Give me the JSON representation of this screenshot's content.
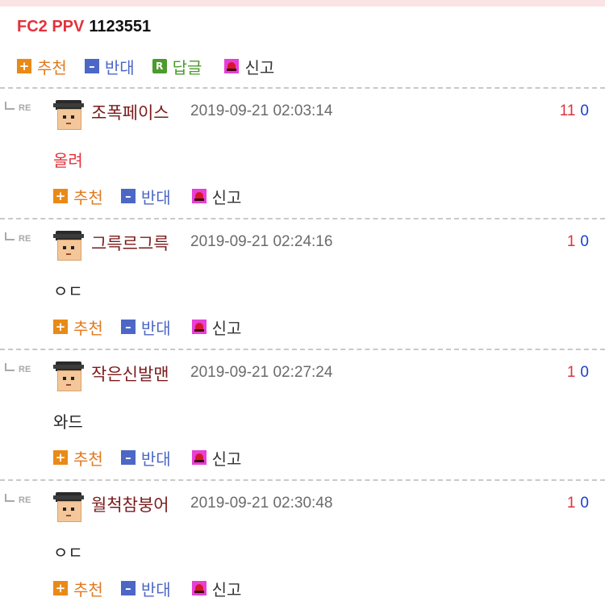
{
  "post": {
    "title_code": "FC2 PPV",
    "title_num": "1123551",
    "actions": {
      "recommend": "추천",
      "oppose": "반대",
      "reply": "답글",
      "report": "신고"
    }
  },
  "comments": [
    {
      "author": "조폭페이스",
      "date": "2019-09-21 02:03:14",
      "up": "11",
      "down": "0",
      "text": "올려",
      "text_color": "#e2323b"
    },
    {
      "author": "그륵르그륵",
      "date": "2019-09-21 02:24:16",
      "up": "1",
      "down": "0",
      "text": "ㅇㄷ",
      "text_color": "#222222"
    },
    {
      "author": "작은신발맨",
      "date": "2019-09-21 02:27:24",
      "up": "1",
      "down": "0",
      "text": "와드",
      "text_color": "#222222"
    },
    {
      "author": "월척참붕어",
      "date": "2019-09-21 02:30:48",
      "up": "1",
      "down": "0",
      "text": "ㅇㄷ",
      "text_color": "#222222"
    }
  ],
  "comment_actions": {
    "recommend": "추천",
    "oppose": "반대",
    "report": "신고"
  },
  "re_label": "RE",
  "colors": {
    "title_red": "#e2323b",
    "author": "#7a1b1b",
    "up_vote": "#e2323b",
    "down_vote": "#1a3fd0"
  },
  "icons": {
    "recommend": "plus-icon",
    "oppose": "minus-icon",
    "reply": "reply-r-icon",
    "report": "siren-icon"
  }
}
